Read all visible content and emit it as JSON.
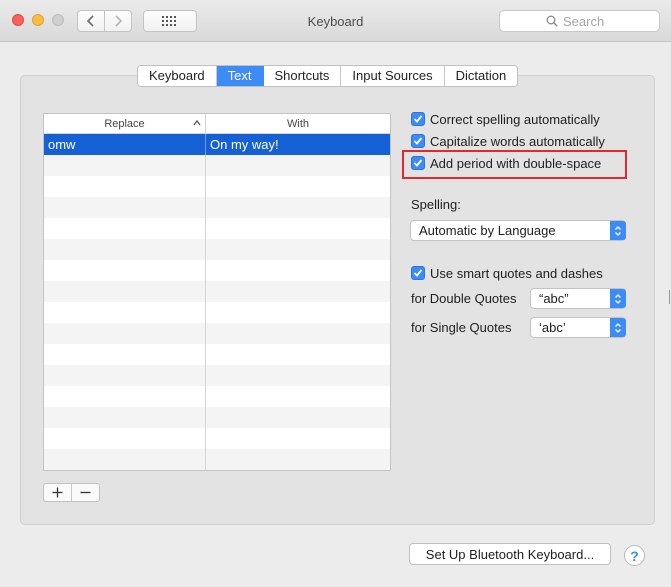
{
  "window": {
    "title": "Keyboard",
    "search_placeholder": "Search"
  },
  "tabs": [
    {
      "label": "Keyboard",
      "active": false
    },
    {
      "label": "Text",
      "active": true
    },
    {
      "label": "Shortcuts",
      "active": false
    },
    {
      "label": "Input Sources",
      "active": false
    },
    {
      "label": "Dictation",
      "active": false
    }
  ],
  "table": {
    "columns": [
      "Replace",
      "With"
    ],
    "rows": [
      {
        "replace": "omw",
        "with": "On my way!",
        "selected": true
      }
    ]
  },
  "options": {
    "correct_spelling": {
      "label": "Correct spelling automatically",
      "checked": true
    },
    "capitalize_words": {
      "label": "Capitalize words automatically",
      "checked": true
    },
    "add_period": {
      "label": "Add period with double-space",
      "checked": true
    },
    "smart_quotes": {
      "label": "Use smart quotes and dashes",
      "checked": true
    }
  },
  "spelling": {
    "label": "Spelling:",
    "value": "Automatic by Language"
  },
  "double_quotes": {
    "label": "for Double Quotes",
    "value": "“abc”"
  },
  "single_quotes": {
    "label": "for Single Quotes",
    "value": "‘abc’"
  },
  "footer": {
    "bluetooth_button": "Set Up Bluetooth Keyboard...",
    "help": "?"
  },
  "colors": {
    "accent": "#3d8bf5",
    "selection": "#1560d5",
    "highlight": "#e2282c"
  }
}
